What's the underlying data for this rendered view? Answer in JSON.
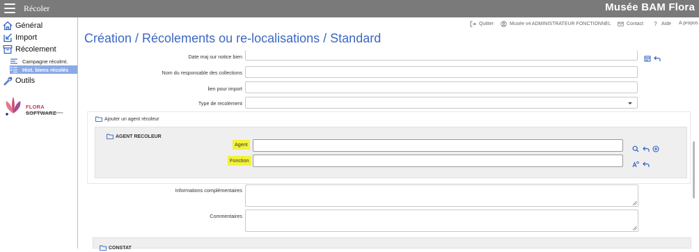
{
  "topbar": {
    "app_title": "Récoler",
    "brand": "Musée BAM Flora"
  },
  "sidebar": {
    "items": [
      {
        "label": "Général"
      },
      {
        "label": "Import"
      },
      {
        "label": "Récolement"
      },
      {
        "label": "Outils"
      }
    ],
    "sub_items": [
      {
        "label": "Campagne récolmt."
      },
      {
        "label": "Hist. biens récolés"
      }
    ],
    "logo": {
      "name_part1": "FLORA",
      "name_part2": " SOFTWARE",
      "tagline": "Bibliothèques | Archives | Musées"
    }
  },
  "header_links": {
    "quit": "Quitter",
    "user": "Musée v4 ADMINISTRATEUR FONCTIONNEL",
    "contact": "Contact",
    "help": "Aide",
    "about": "A propos"
  },
  "page_title": "Création / Récolements ou re-localisations / Standard",
  "form": {
    "date_maj_label": "Date maj sur notice bien",
    "date_maj_value": "",
    "responsable_label": "Nom du responsable des collections",
    "responsable_value": "",
    "lien_label": "lien pour import",
    "lien_value": "",
    "type_label": "Type de recolement",
    "type_value": "",
    "agent_section_title": "Ajouter un agent récoleur",
    "agent_subsection_title": "AGENT RECOLEUR",
    "agent_label": "Agent",
    "agent_value": "",
    "fonction_label": "Fonction",
    "fonction_value": "",
    "infos_label": "Informations complémentaires",
    "infos_value": "",
    "commentaires_label": "Commentaires",
    "commentaires_value": "",
    "constat_title": "CONSTAT"
  },
  "colors": {
    "title_blue": "#3b67c4",
    "icon_blue": "#2f5fbf",
    "highlight": "#f2f23a",
    "topbar": "#7a7a7a",
    "active_nav": "#8aa9e6"
  },
  "icons": [
    "menu-icon",
    "home-icon",
    "import-icon",
    "archive-icon",
    "list-icon",
    "checklist-icon",
    "wrench-icon",
    "quit-icon",
    "user-icon",
    "mail-icon",
    "help-icon",
    "calendar-icon",
    "undo-icon",
    "search-icon",
    "add-circle-icon",
    "text-format-icon",
    "folder-icon"
  ]
}
